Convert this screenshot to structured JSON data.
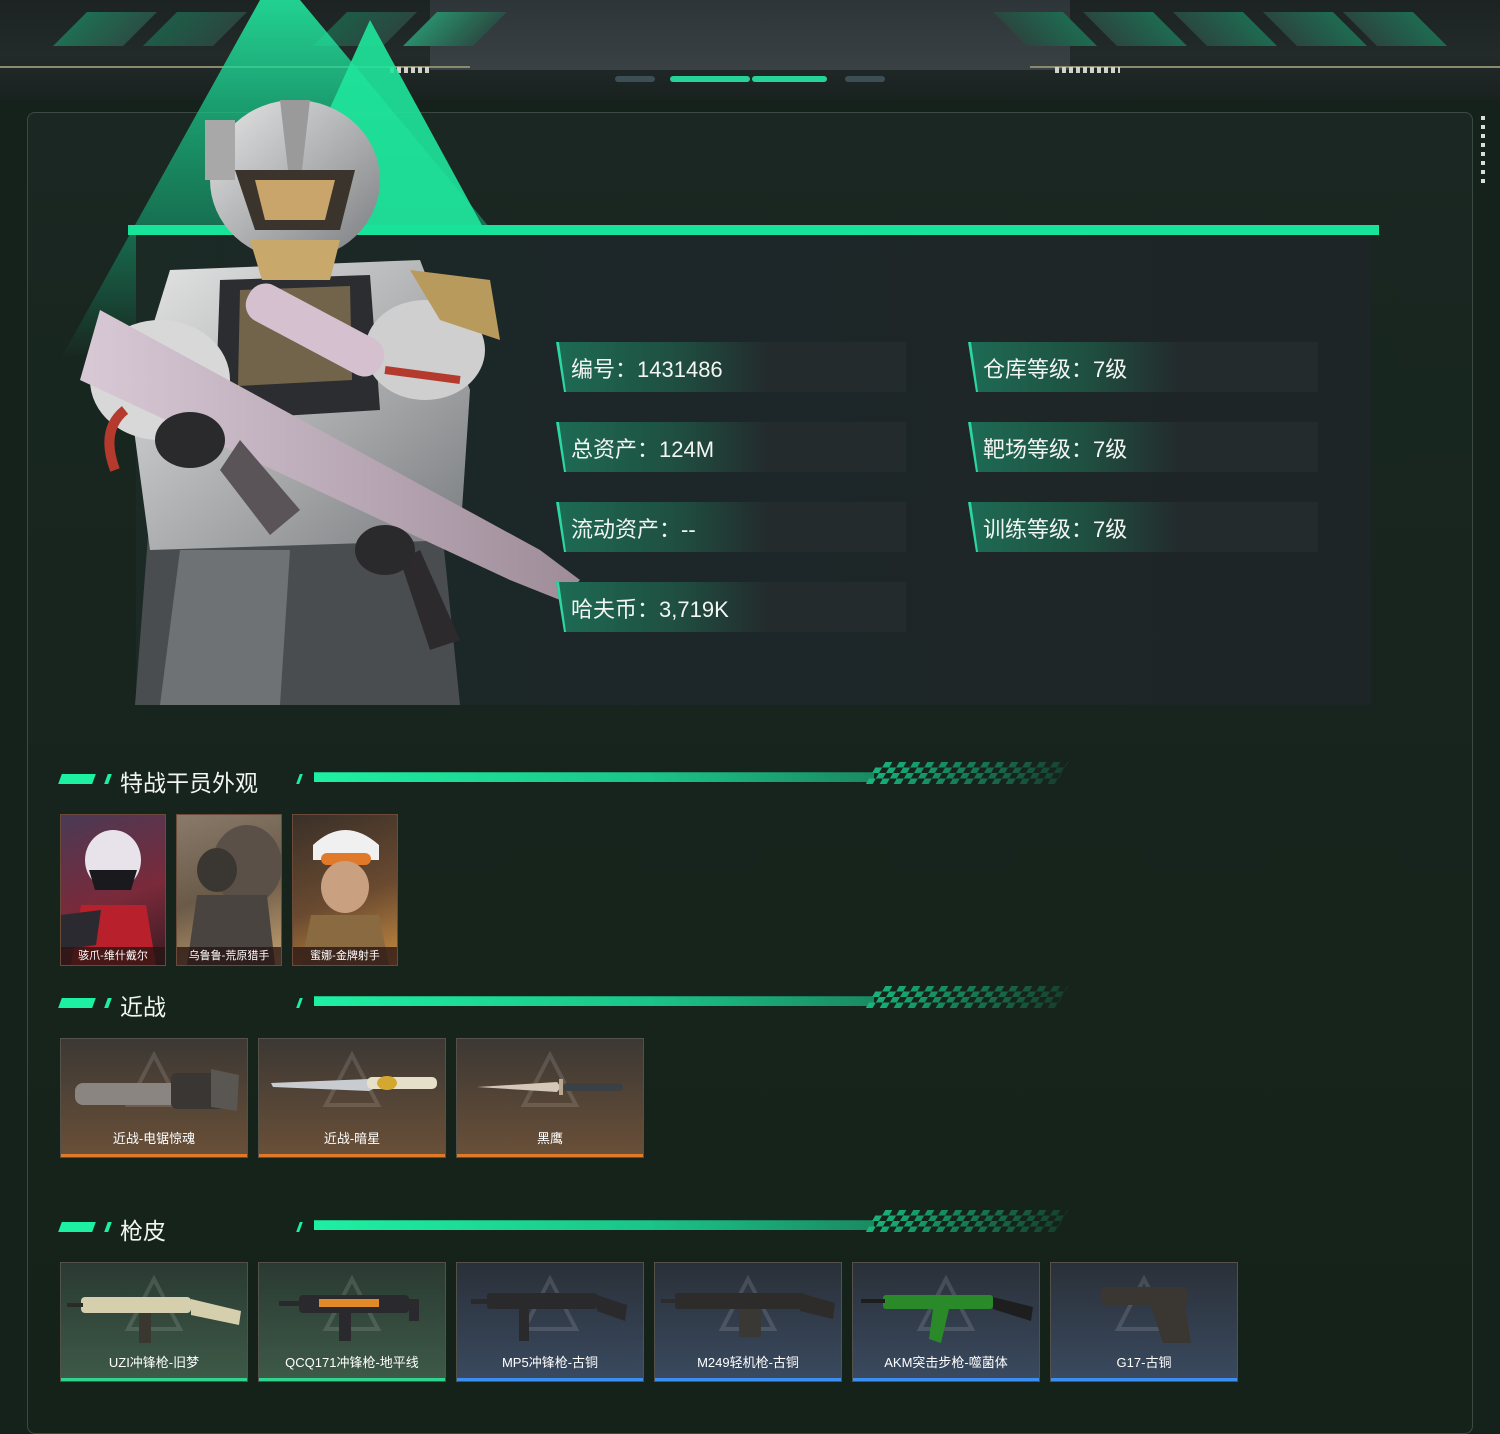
{
  "colors": {
    "accent": "#1ef0a2",
    "background": "#15221c",
    "melee_underline": "#e07a2a",
    "green_underline": "#2fd58d",
    "blue_underline": "#3c8ff0"
  },
  "profile": {
    "operator_image": "armored-operator-with-rifle",
    "fields": [
      {
        "label": "编号：",
        "value": "1431486"
      },
      {
        "label": "仓库等级：",
        "value": "7级"
      },
      {
        "label": "总资产：",
        "value": "124M"
      },
      {
        "label": "靶场等级：",
        "value": "7级"
      },
      {
        "label": "流动资产：",
        "value": "--"
      },
      {
        "label": "训练等级：",
        "value": "7级"
      },
      {
        "label": "哈夫币：",
        "value": "3,719K"
      }
    ]
  },
  "sections": {
    "skins": {
      "title": "特战干员外观",
      "items": [
        "骇爪-维什戴尔",
        "乌鲁鲁-荒原猎手",
        "蜜娜-金牌射手"
      ]
    },
    "melee": {
      "title": "近战",
      "items": [
        "近战-电锯惊魂",
        "近战-暗星",
        "黑鹰"
      ]
    },
    "gun_skins": {
      "title": "枪皮",
      "items": [
        "UZI冲锋枪-旧梦",
        "QCQ171冲锋枪-地平线",
        "MP5冲锋枪-古铜",
        "M249轻机枪-古铜",
        "AKM突击步枪-噬菌体",
        "G17-古铜"
      ]
    }
  }
}
